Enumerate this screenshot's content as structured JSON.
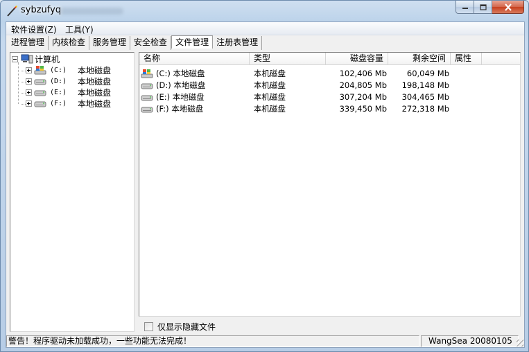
{
  "window": {
    "title": "sybzufyq"
  },
  "menu": [
    {
      "label": "软件设置(Z)"
    },
    {
      "label": "工具(Y)"
    }
  ],
  "tabs": [
    {
      "label": "进程管理"
    },
    {
      "label": "内核检查"
    },
    {
      "label": "服务管理"
    },
    {
      "label": "安全检查"
    },
    {
      "label": "文件管理",
      "active": true
    },
    {
      "label": "注册表管理"
    }
  ],
  "tree": {
    "root": {
      "label": "计算机",
      "icon": "computer-icon"
    },
    "drives": [
      {
        "letter": "(C:)",
        "label": "本地磁盘",
        "icon": "system-drive-icon"
      },
      {
        "letter": "(D:)",
        "label": "本地磁盘",
        "icon": "hard-drive-icon"
      },
      {
        "letter": "(E:)",
        "label": "本地磁盘",
        "icon": "hard-drive-icon"
      },
      {
        "letter": "(F:)",
        "label": "本地磁盘",
        "icon": "hard-drive-icon"
      }
    ]
  },
  "list": {
    "columns": [
      "名称",
      "类型",
      "磁盘容量",
      "剩余空间",
      "属性"
    ],
    "rows": [
      {
        "name": "(C:) 本地磁盘",
        "type": "本机磁盘",
        "capacity": "102,406 Mb",
        "free": "60,049 Mb",
        "attr": "",
        "icon": "system-drive-icon"
      },
      {
        "name": "(D:) 本地磁盘",
        "type": "本机磁盘",
        "capacity": "204,805 Mb",
        "free": "198,148 Mb",
        "attr": "",
        "icon": "hard-drive-icon"
      },
      {
        "name": "(E:) 本地磁盘",
        "type": "本机磁盘",
        "capacity": "307,204 Mb",
        "free": "304,465 Mb",
        "attr": "",
        "icon": "hard-drive-icon"
      },
      {
        "name": "(F:) 本地磁盘",
        "type": "本机磁盘",
        "capacity": "339,450 Mb",
        "free": "272,318 Mb",
        "attr": "",
        "icon": "hard-drive-icon"
      }
    ]
  },
  "options": {
    "show_hidden_label": "仅显示隐藏文件",
    "show_hidden_checked": false
  },
  "status": {
    "message": "警告！程序驱动未加载成功，一些功能无法完成！",
    "version": "WangSea 20080105"
  }
}
